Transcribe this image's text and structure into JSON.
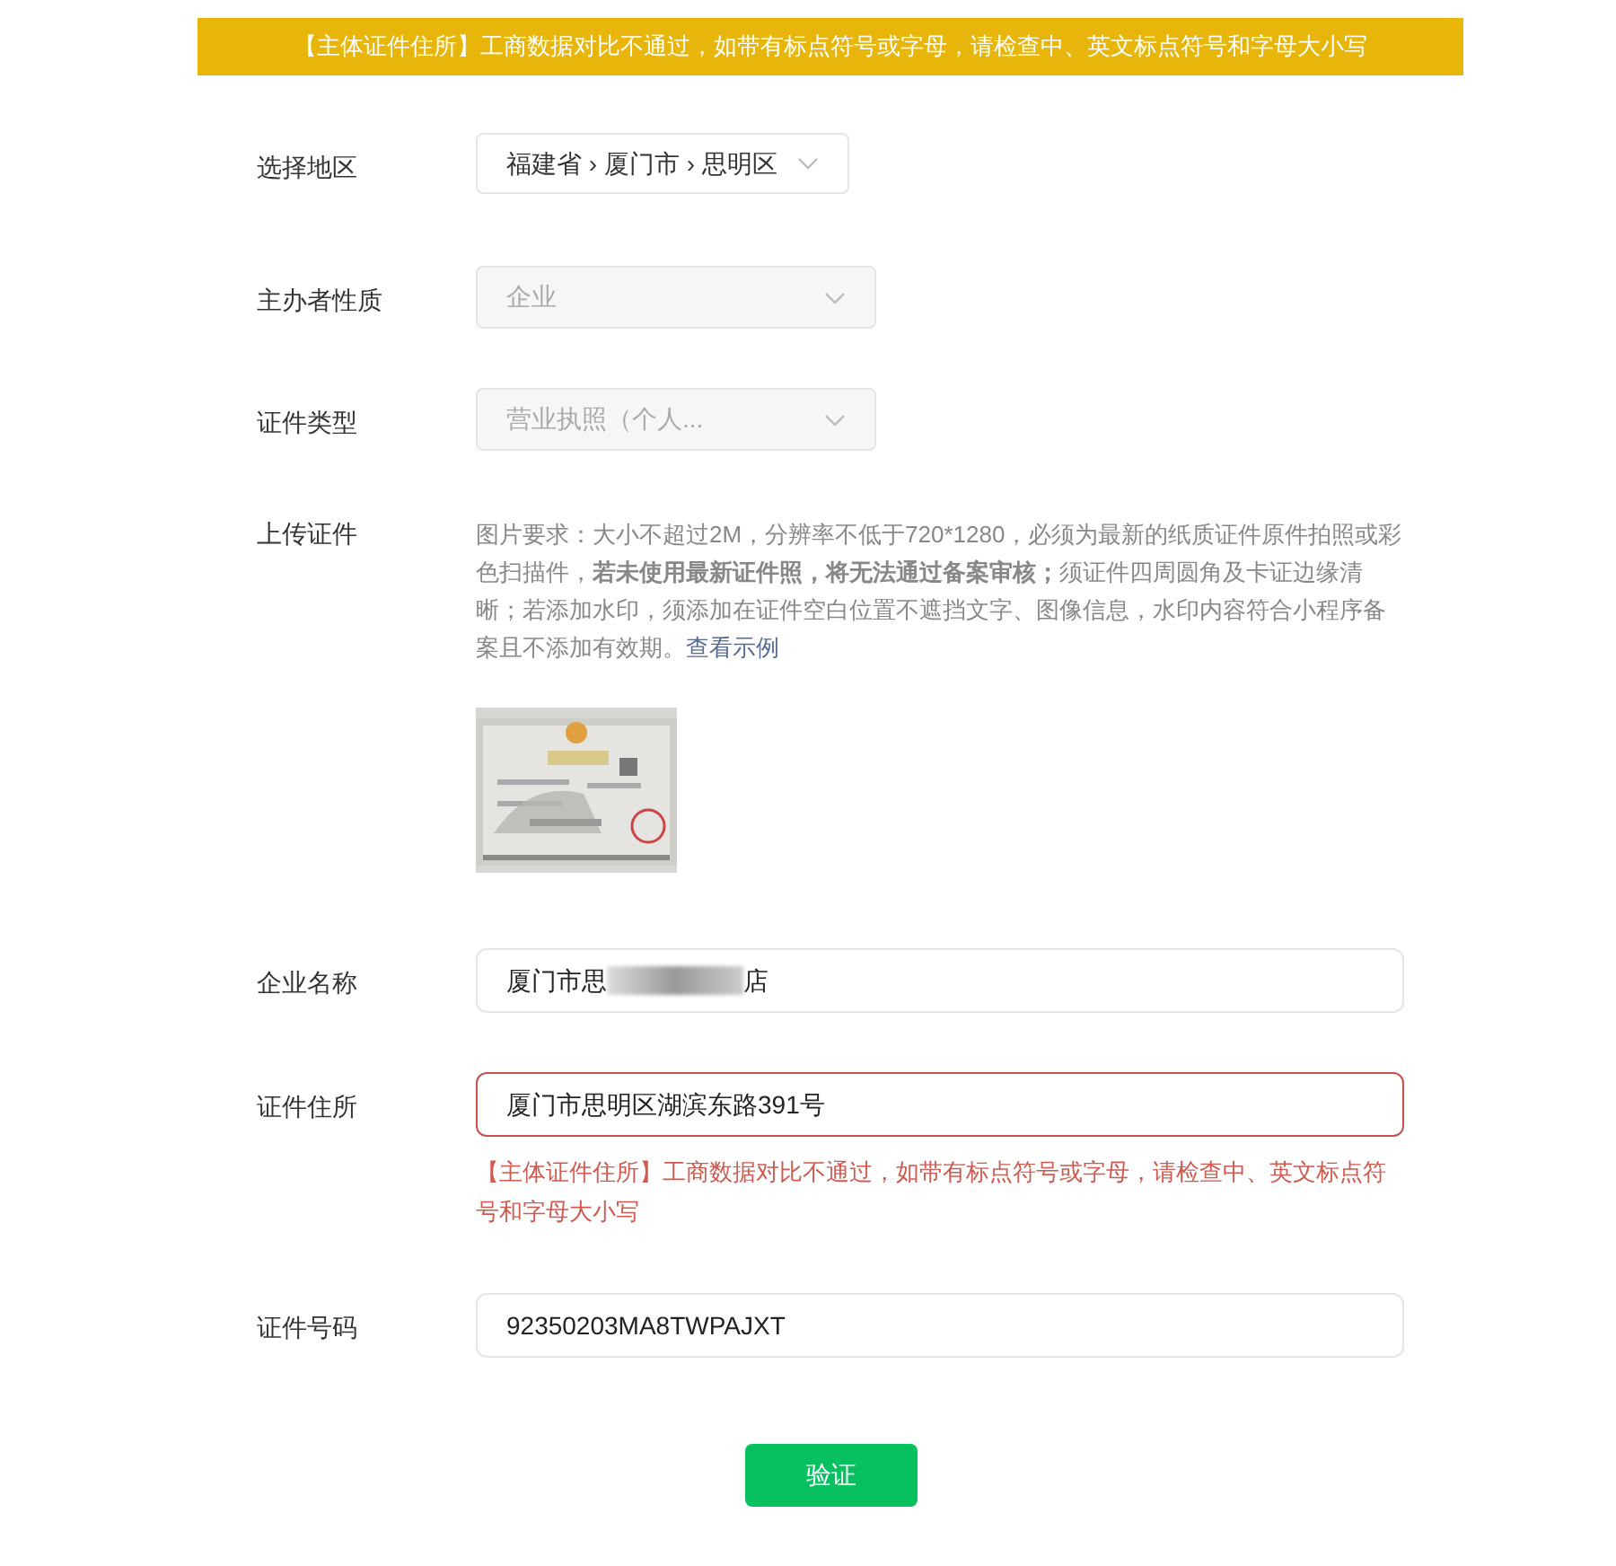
{
  "banner": {
    "text": "【主体证件住所】工商数据对比不通过，如带有标点符号或字母，请检查中、英文标点符号和字母大小写"
  },
  "fields": [
    {
      "kind": "region",
      "label": "选择地区",
      "parts": [
        "福建省",
        "厦门市",
        "思明区"
      ],
      "separator": "›",
      "disabled": false
    },
    {
      "kind": "select",
      "label": "主办者性质",
      "value": "企业",
      "disabled": true
    },
    {
      "kind": "select",
      "label": "证件类型",
      "value": "营业执照（个人...",
      "disabled": true
    },
    {
      "kind": "upload",
      "label": "上传证件",
      "description": "图片要求：大小不超过2M，分辨率不低于720*1280，必须为最新的纸质证件原件拍照或彩色扫描件，**若未使用最新证件照，将无法通过备案审核；**须证件四周圆角及卡证边缘清晰；若添加水印，须添加在证件空白位置不遮挡文字、图像信息，水印内容符合小程序备案且不添加有效期。",
      "link": "查看示例"
    },
    {
      "kind": "text",
      "label": "企业名称",
      "value": "厦门市思",
      "value_end": "店",
      "redacted": true,
      "error": false
    },
    {
      "kind": "text",
      "label": "证件住所",
      "value": "厦门市思明区湖滨东路391号",
      "error": true,
      "error_text": "【主体证件住所】工商数据对比不通过，如带有标点符号或字母，请检查中、英文标点符号和字母大小写"
    },
    {
      "kind": "text",
      "label": "证件号码",
      "value": "92350203MA8TWPAJXT",
      "error": false
    }
  ],
  "submit": {
    "label": "验证"
  }
}
